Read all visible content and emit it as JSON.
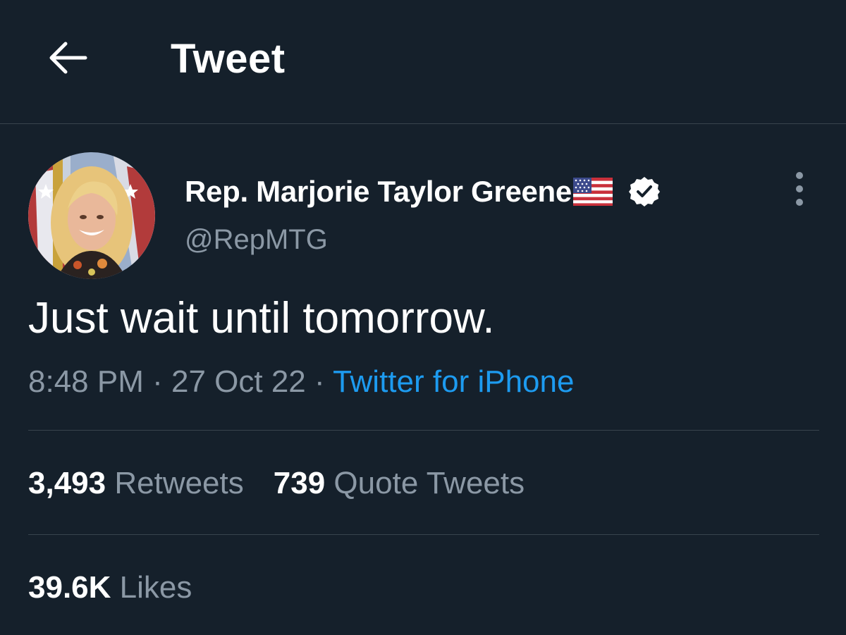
{
  "header": {
    "title": "Tweet",
    "back_icon": "arrow-left-icon"
  },
  "author": {
    "name": "Rep. Marjorie Taylor Greene",
    "handle": "@RepMTG",
    "flag_emoji": "us-flag-icon",
    "verified_icon": "verified-badge-icon"
  },
  "tweet": {
    "text": "Just wait until tomorrow.",
    "time": "8:48 PM",
    "sep1": " · ",
    "date": "27 Oct 22",
    "sep2": " · ",
    "source": "Twitter for iPhone"
  },
  "stats": {
    "retweets_count": "3,493",
    "retweets_label": "Retweets",
    "quotes_count": "739",
    "quotes_label": "Quote Tweets",
    "likes_count": "39.6K",
    "likes_label": "Likes"
  },
  "colors": {
    "background": "#15202b",
    "text": "#ffffff",
    "secondary": "#8b98a5",
    "accent": "#1d9bf0",
    "divider": "#38444d"
  }
}
